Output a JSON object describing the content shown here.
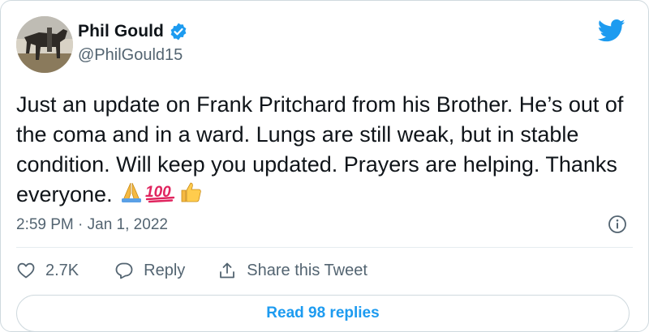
{
  "author": {
    "name": "Phil Gould",
    "handle": "@PhilGould15"
  },
  "icons": {
    "logo": "twitter-bird-icon",
    "verified": "verified-badge-icon",
    "info": "info-icon",
    "like": "heart-icon",
    "reply": "speech-bubble-icon",
    "share": "share-upload-icon"
  },
  "tweet": {
    "text": "Just an update on Frank Pritchard from his Brother. He’s out of the coma and in a ward. Lungs are still weak, but in stable condition. Will keep you updated. Prayers are helping. Thanks everyone.",
    "emojis": [
      "folded-hands",
      "hundred-points",
      "thumbs-up"
    ],
    "timestamp": "2:59 PM · Jan 1, 2022"
  },
  "actions": {
    "like_count": "2.7K",
    "reply_label": "Reply",
    "share_label": "Share this Tweet"
  },
  "footer": {
    "read_replies_label": "Read 98 replies"
  },
  "colors": {
    "accent": "#1d9bf0",
    "secondary_text": "#536471",
    "border": "#cfd9de"
  }
}
